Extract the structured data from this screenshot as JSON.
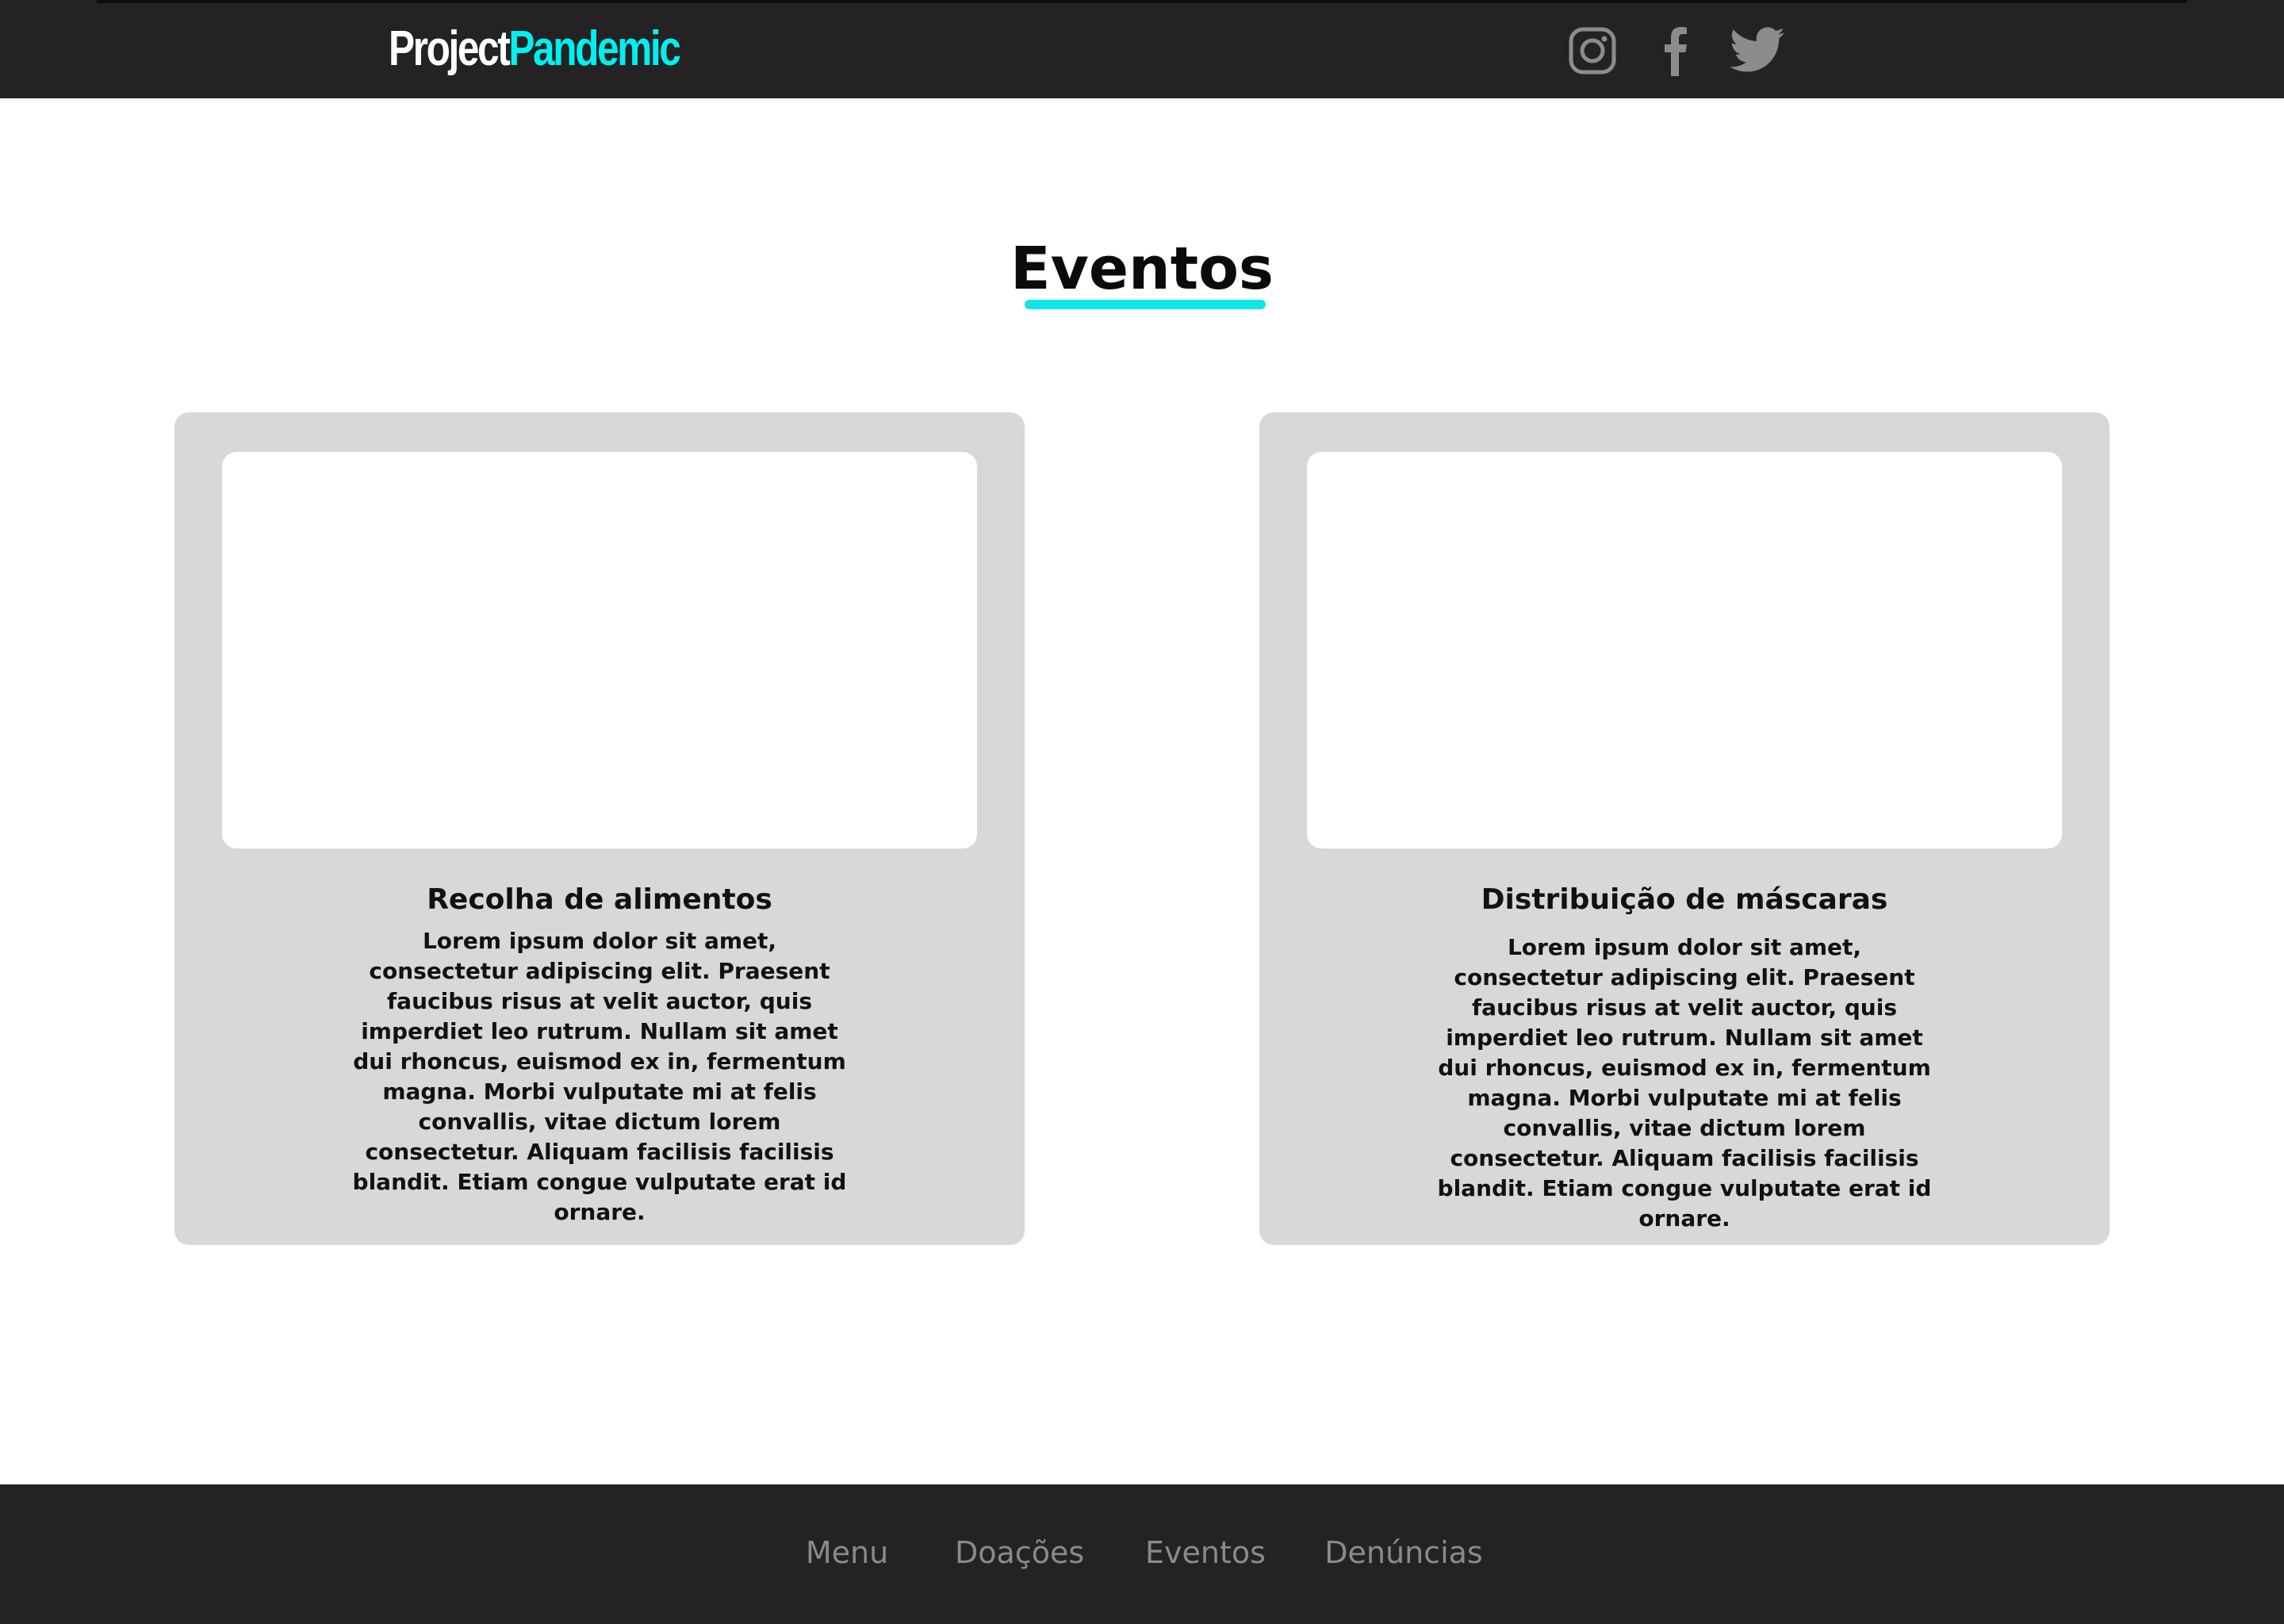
{
  "header": {
    "logo_word1": "Project",
    "logo_word2": "Pandemic",
    "social": [
      {
        "name": "instagram",
        "icon": "instagram-icon"
      },
      {
        "name": "facebook",
        "icon": "facebook-icon"
      },
      {
        "name": "twitter",
        "icon": "twitter-icon"
      }
    ]
  },
  "main": {
    "title": "Eventos",
    "cards": [
      {
        "title": "Recolha de alimentos",
        "text": "Lorem ipsum dolor sit amet, consectetur adipiscing elit. Praesent faucibus risus at velit auctor, quis imperdiet leo rutrum. Nullam sit amet dui rhoncus, euismod ex in, fermentum magna. Morbi vulputate mi at felis convallis, vitae dictum lorem consectetur. Aliquam facilisis facilisis blandit. Etiam congue vulputate erat id ornare."
      },
      {
        "title": "Distribuição de máscaras",
        "text": "Lorem ipsum dolor sit amet, consectetur adipiscing elit. Praesent faucibus risus at velit auctor, quis imperdiet leo rutrum. Nullam sit amet dui rhoncus, euismod ex in, fermentum magna. Morbi vulputate mi at felis convallis, vitae dictum lorem consectetur. Aliquam facilisis facilisis blandit. Etiam congue vulputate erat id ornare."
      }
    ]
  },
  "footer": {
    "links": [
      "Menu",
      "Doações",
      "Eventos",
      "Denúncias"
    ]
  },
  "colors": {
    "header_bg": "#242223",
    "accent": "#00f0f0",
    "card_bg": "#d8d8d8",
    "footer_link": "#8a8a8a",
    "icon": "#8c8c8c"
  }
}
